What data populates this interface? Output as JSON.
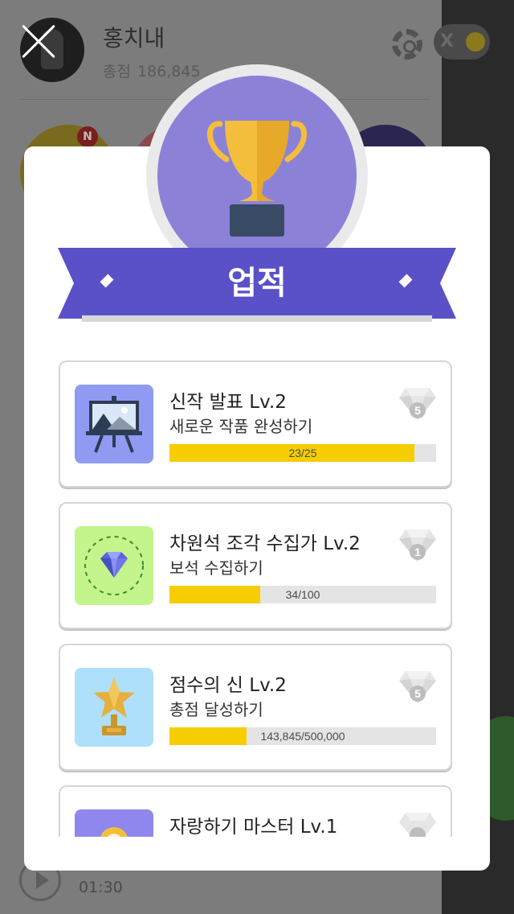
{
  "background": {
    "user_name": "홍치내",
    "score_label": "총점",
    "score_value": "186,845",
    "new_badge": "N",
    "time": "01:30",
    "currency_partial": "X"
  },
  "modal": {
    "title": "업적",
    "achievements": [
      {
        "title": "신작 발표 Lv.2",
        "desc": "새로운 작품 완성하기",
        "progress_text": "23/25",
        "progress": 0.92,
        "reward": "5",
        "thumb": "easel-icon"
      },
      {
        "title": "차원석 조각 수집가 Lv.2",
        "desc": "보석 수집하기",
        "progress_text": "34/100",
        "progress": 0.34,
        "reward": "1",
        "thumb": "gem-icon"
      },
      {
        "title": "점수의 신 Lv.2",
        "desc": "총점 달성하기",
        "progress_text": "143,845/500,000",
        "progress": 0.29,
        "reward": "5",
        "thumb": "star-trophy-icon"
      },
      {
        "title": "자랑하기 마스터 Lv.1",
        "desc": "",
        "progress_text": "",
        "progress": 0,
        "reward": "",
        "thumb": "medal-icon"
      }
    ]
  },
  "colors": {
    "accent_purple": "#5a50c8",
    "trophy_disc": "#8b82d8",
    "trophy_gold": "#f3be3c",
    "progress_fill": "#f6cd00"
  }
}
